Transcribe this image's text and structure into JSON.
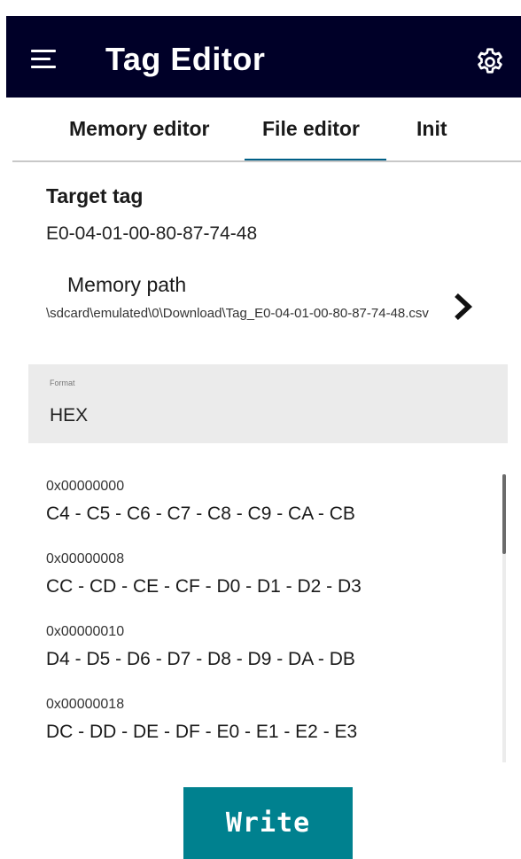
{
  "app_bar": {
    "title": "Tag Editor",
    "background_color": "#000028",
    "menu_icon": "hamburger-menu-icon",
    "settings_icon": "gear-icon"
  },
  "tabs": [
    {
      "label": "Memory editor",
      "selected": false
    },
    {
      "label": "File editor",
      "selected": true
    },
    {
      "label": "Init",
      "selected": false
    }
  ],
  "tab_indicator_color": "#005f87",
  "target_tag": {
    "label": "Target tag",
    "value": "E0-04-01-00-80-87-74-48"
  },
  "memory_path": {
    "label": "Memory path",
    "value": "\\sdcard\\emulated\\0\\Download\\Tag_E0-04-01-00-80-87-74-48.csv",
    "chevron_icon": "chevron-right-icon"
  },
  "format": {
    "label": "Format",
    "value": "HEX"
  },
  "hex_rows": [
    {
      "address": "0x00000000",
      "bytes": "C4 - C5 - C6 - C7 - C8 - C9 - CA - CB"
    },
    {
      "address": "0x00000008",
      "bytes": "CC - CD - CE - CF - D0 - D1 - D2 - D3"
    },
    {
      "address": "0x00000010",
      "bytes": "D4 - D5 - D6 - D7 - D8 - D9 - DA - DB"
    },
    {
      "address": "0x00000018",
      "bytes": "DC - DD - DE - DF - E0 - E1 - E2 - E3"
    }
  ],
  "write_button": {
    "label": "Write",
    "color": "#00818f"
  }
}
